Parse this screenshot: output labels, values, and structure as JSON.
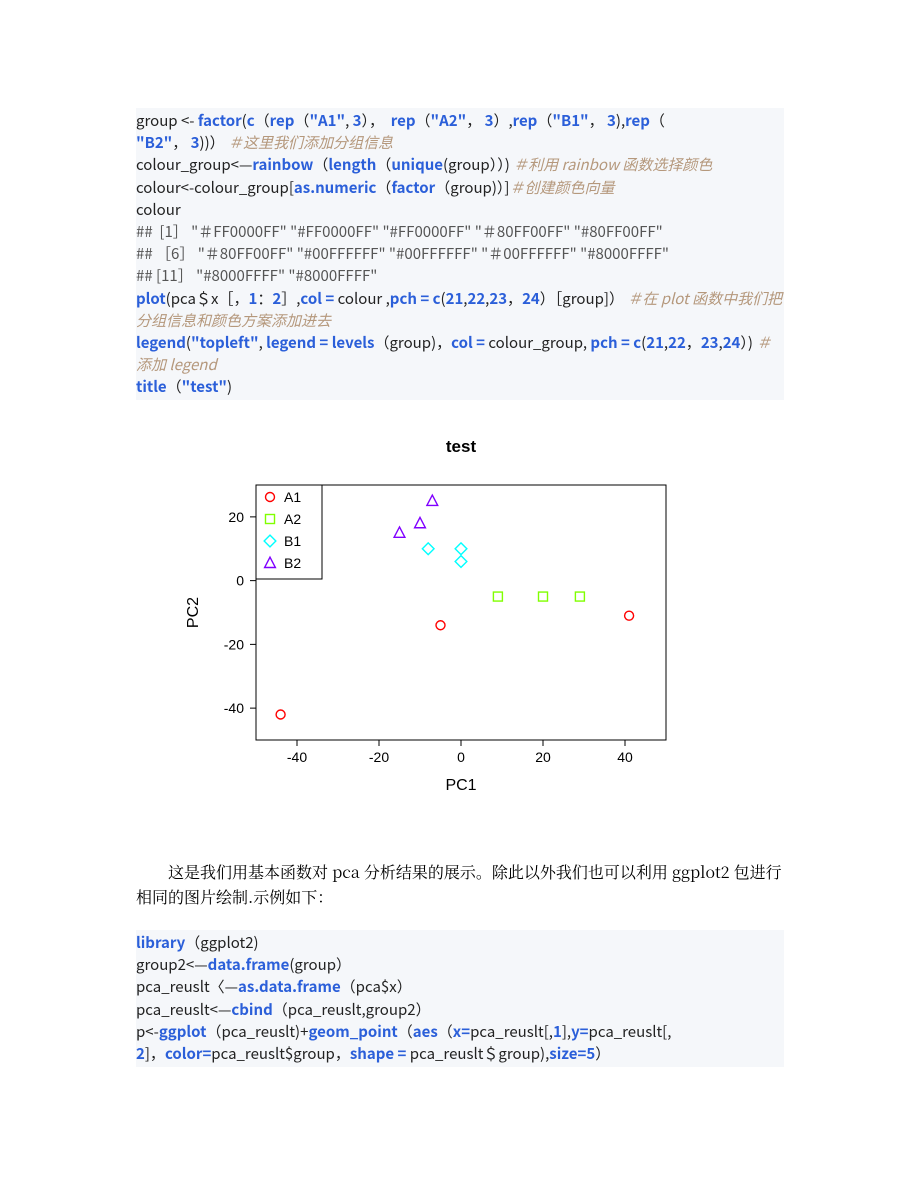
{
  "code1": {
    "l1a": "group <- ",
    "l1_factor": "factor",
    "l1b": "(",
    "l1_c": "c",
    "l1c": "（",
    "l1_rep1": "rep",
    "l1d": "（",
    "l1_a1": "\"A1\"",
    "l1e": ", ",
    "l1_3a": "3",
    "l1f": "），  ",
    "l1_rep2": "rep",
    "l1g": "（",
    "l1_a2": "\"A2\"",
    "l1h": "， ",
    "l1_3b": "3",
    "l1i": "）,",
    "l1_rep3": "rep",
    "l1j": "（",
    "l1_b1": "\"B1\"",
    "l1k": "， ",
    "l1_3c": "3",
    "l1l": "),",
    "l1_rep4": "rep",
    "l1m": "（",
    "l2_b2": "\"B2\"",
    "l2a": "， ",
    "l2_3d": "3",
    "l2b": "))）",
    "l2_cm": "＃这里我们添加分组信息",
    "l3a": "colour_group<—",
    "l3_rainbow": "rainbow",
    "l3b": "（",
    "l3_length": "length",
    "l3c": "（",
    "l3_unique": "unique",
    "l3d": "(group））)",
    "l3_cm": "＃利用 rainbow 函数选择颜色",
    "l4a": "colour<-colour_group[",
    "l4_asn": "as.numeric",
    "l4b": "（",
    "l4_factor": "factor",
    "l4c": "（group)）]",
    "l4_cm": "＃创建颜色向量",
    "l5": "colour",
    "out1": "##  [1］ \"＃FF0000FF\" \"#FF0000FF\" \"#FF0000FF\" \"＃80FF00FF\" \"#80FF00FF\"",
    "out2": "## ［6］ \"＃80FF00FF\" \"#00FFFFFF\" \"#00FFFFFF\" \"＃00FFFFFF\" \"#8000FFFF\"",
    "out3": "## [11］ \"#8000FFFF\" \"#8000FFFF\"",
    "p1_plot": "plot",
    "p1a": "(pca＄x［，",
    "p1_1": "1",
    "p1b": "：",
    "p1_2": "2",
    "p1c": "］,",
    "p1_col": "col = ",
    "p1d": "colour ,",
    "p1_pch": "pch = ",
    "p1_c": "c",
    "p1e": "(",
    "p1_21": "21",
    "p1f": ",",
    "p1_22": "22",
    "p1g": ",",
    "p1_23": "23",
    "p1h": "，",
    "p1_24": "24",
    "p1i": "）［group]）",
    "p1_cm": "＃在 plot 函数中我们把分组信息和颜色方案添加进去",
    "lg_legend": "legend",
    "lg_a": "(",
    "lg_tl": "\"topleft\"",
    "lg_b": ", ",
    "lg_leg": "legend = ",
    "lg_levels": "levels",
    "lg_c": "（group)，",
    "lg_col": "col = ",
    "lg_d": "colour_group, ",
    "lg_pch": "pch = ",
    "lg_cvec": "c",
    "lg_e": "(",
    "lg_21": "21",
    "lg_f": ",",
    "lg_22": "22",
    "lg_g": "，",
    "lg_23": "23",
    "lg_h": ",",
    "lg_24": "24",
    "lg_i": "）)",
    "lg_cm": "＃添加 legend",
    "t_title": "title",
    "t_a": "（",
    "t_test": "\"test\"",
    "t_b": ")"
  },
  "para": "这是我们用基本函数对 pca 分析结果的展示。除此以外我们也可以利用 ggplot2 包进行相同的图片绘制.示例如下：",
  "code2": {
    "l1_lib": "library",
    "l1a": "（ggplot2)",
    "l2a": "group2<—",
    "l2_df": "data.frame",
    "l2b": "(group）",
    "l3a": "pca_reuslt〈—",
    "l3_adf": "as.data.frame",
    "l3b": "（pca$x）",
    "l4a": "pca_reuslt<—",
    "l4_cbind": "cbind",
    "l4b": "（pca_reuslt,group2）",
    "l5a": "p<-",
    "l5_ggplot": "ggplot",
    "l5b": "（pca_reuslt)+",
    "l5_geom": "geom_point",
    "l5c": "（",
    "l5_aes": "aes",
    "l5d": "（",
    "l5_x": "x=",
    "l5e": "pca_reuslt[,",
    "l5_1": "1",
    "l5f": "],",
    "l5_y": "y=",
    "l5g": "pca_reuslt[,",
    "l6_2": "2",
    "l6a": "]，",
    "l6_color": "color=",
    "l6b": "pca_reuslt$group，",
    "l6_shape": "shape = ",
    "l6c": "pca_reuslt＄group),",
    "l6_size": "size=",
    "l6_5": "5",
    "l6d": "）"
  },
  "chart_data": {
    "type": "scatter",
    "title": "test",
    "xlabel": "PC1",
    "ylabel": "PC2",
    "xlim": [
      -50,
      50
    ],
    "ylim": [
      -50,
      30
    ],
    "xticks": [
      -40,
      -20,
      0,
      20,
      40
    ],
    "yticks": [
      -40,
      -20,
      0,
      20
    ],
    "legend_position": "topleft",
    "series": [
      {
        "name": "A1",
        "pch": 21,
        "color": "#FF0000",
        "points": [
          {
            "x": -44,
            "y": -42
          },
          {
            "x": -5,
            "y": -14
          },
          {
            "x": 41,
            "y": -11
          }
        ]
      },
      {
        "name": "A2",
        "pch": 22,
        "color": "#80FF00",
        "points": [
          {
            "x": 9,
            "y": -5
          },
          {
            "x": 20,
            "y": -5
          },
          {
            "x": 29,
            "y": -5
          }
        ]
      },
      {
        "name": "B1",
        "pch": 23,
        "color": "#00FFFF",
        "points": [
          {
            "x": -8,
            "y": 10
          },
          {
            "x": 0,
            "y": 10
          },
          {
            "x": 0,
            "y": 6
          }
        ]
      },
      {
        "name": "B2",
        "pch": 24,
        "color": "#8000FF",
        "points": [
          {
            "x": -15,
            "y": 15
          },
          {
            "x": -10,
            "y": 18
          },
          {
            "x": -7,
            "y": 25
          }
        ]
      }
    ]
  }
}
